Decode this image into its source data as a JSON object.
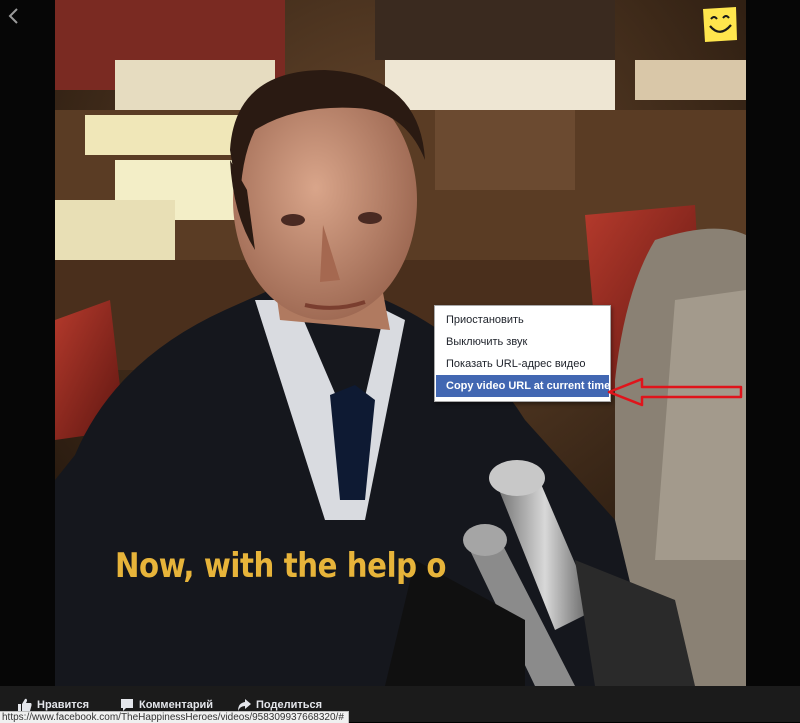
{
  "video": {
    "caption": "Now, with the help o"
  },
  "context_menu": {
    "items": [
      {
        "label": "Приостановить",
        "active": false
      },
      {
        "label": "Выключить звук",
        "active": false
      },
      {
        "label": "Показать URL-адрес видео",
        "active": false
      },
      {
        "label": "Copy video URL at current time",
        "active": true
      }
    ]
  },
  "actions": {
    "like_label": "Нравится",
    "comment_label": "Комментарий",
    "share_label": "Поделиться"
  },
  "status_bar": {
    "url": "https://www.facebook.com/TheHappinessHeroes/videos/958309937668320/#"
  },
  "icons": {
    "back": "chevron-left-icon",
    "sticker": "smiley-sticker-icon",
    "like": "thumbs-up-icon",
    "comment": "comment-icon",
    "share": "share-arrow-icon",
    "annotation": "red-arrow-icon"
  },
  "colors": {
    "caption": "#e7b43a",
    "menu_highlight": "#4267b2",
    "annotation": "#e0141b",
    "sticker": "#ffe64d"
  }
}
